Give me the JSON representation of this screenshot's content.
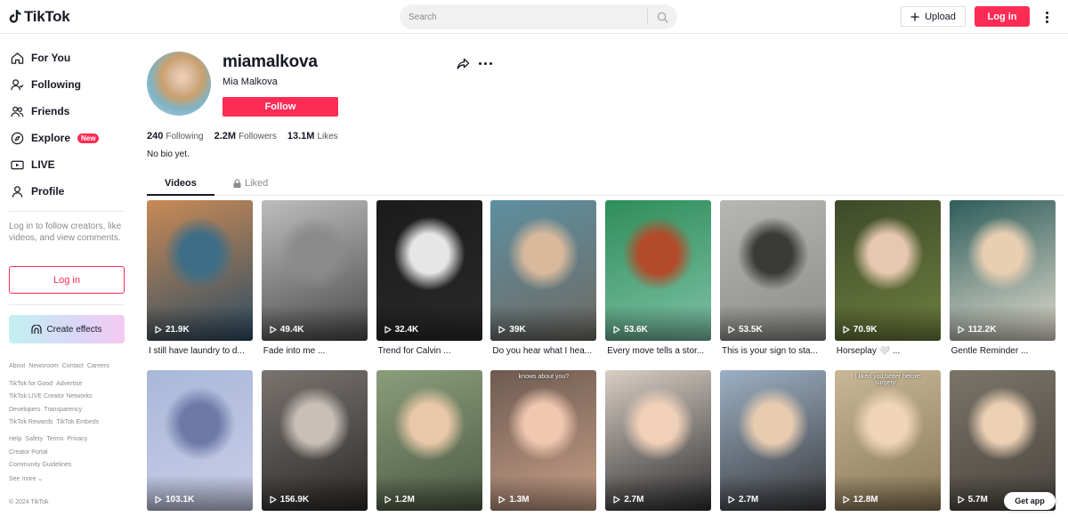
{
  "header": {
    "logo_text": "TikTok",
    "search_placeholder": "Search",
    "upload_label": "Upload",
    "login_label": "Log in"
  },
  "sidebar": {
    "nav": [
      {
        "label": "For You",
        "icon": "home-icon"
      },
      {
        "label": "Following",
        "icon": "following-icon"
      },
      {
        "label": "Friends",
        "icon": "friends-icon"
      },
      {
        "label": "Explore",
        "icon": "compass-icon",
        "badge": "New"
      },
      {
        "label": "LIVE",
        "icon": "live-icon"
      },
      {
        "label": "Profile",
        "icon": "profile-icon"
      }
    ],
    "login_message": "Log in to follow creators, like videos, and view comments.",
    "login_button": "Log in",
    "create_effects": "Create effects",
    "footer_rows": [
      [
        "About",
        "Newsroom",
        "Contact",
        "Careers"
      ],
      [
        "TikTok for Good",
        "Advertise"
      ],
      [
        "TikTok LIVE Creator Networks"
      ],
      [
        "Developers",
        "Transparency"
      ],
      [
        "TikTok Rewards",
        "TikTok Embeds"
      ],
      [
        "Help",
        "Safety",
        "Terms",
        "Privacy"
      ],
      [
        "Creator Portal"
      ],
      [
        "Community Guidelines"
      ],
      [
        "See more ⌄"
      ]
    ],
    "copyright": "© 2024 TikTok"
  },
  "profile": {
    "username": "miamalkova",
    "nickname": "Mia Malkova",
    "follow_label": "Follow",
    "stats": {
      "following_count": "240",
      "following_label": "Following",
      "followers_count": "2.2M",
      "followers_label": "Followers",
      "likes_count": "13.1M",
      "likes_label": "Likes"
    },
    "bio": "No bio yet."
  },
  "tabs": {
    "videos": "Videos",
    "liked": "Liked"
  },
  "videos": [
    {
      "views": "21.9K",
      "caption": "I still have laundry to d...",
      "colors": [
        "#c98a56",
        "#3e6e86",
        "#2e4d63"
      ]
    },
    {
      "views": "49.4K",
      "caption": "Fade into me ...",
      "colors": [
        "#bdbdbd",
        "#8a8a8a",
        "#4a4a4a"
      ]
    },
    {
      "views": "32.4K",
      "caption": "Trend for Calvin ...",
      "colors": [
        "#1b1b1b",
        "#e6e6e6",
        "#2a2a2a"
      ]
    },
    {
      "views": "39K",
      "caption": "Do you hear what I hea...",
      "colors": [
        "#5d8fa0",
        "#d9b99c",
        "#6f6a63"
      ]
    },
    {
      "views": "53.6K",
      "caption": "Every move tells a stor...",
      "colors": [
        "#2e8e59",
        "#b34a2a",
        "#7fc1a8"
      ]
    },
    {
      "views": "53.5K",
      "caption": "This is your sign to sta...",
      "colors": [
        "#b6b6b3",
        "#3a3a38",
        "#8d8c88"
      ]
    },
    {
      "views": "70.9K",
      "caption": "Horseplay 🤍 ...",
      "colors": [
        "#3d4a2a",
        "#e6c8b0",
        "#6f7f3e"
      ]
    },
    {
      "views": "112.2K",
      "caption": "Gentle Reminder ...",
      "colors": [
        "#2e5d5a",
        "#e9cfb2",
        "#e3dccf"
      ]
    },
    {
      "views": "103.1K",
      "caption": "",
      "colors": [
        "#a9b8d8",
        "#6d7aa8",
        "#c9cde8"
      ]
    },
    {
      "views": "156.9K",
      "caption": "",
      "colors": [
        "#7a7470",
        "#c8c0b8",
        "#2c2a28"
      ]
    },
    {
      "views": "1.2M",
      "caption": "",
      "colors": [
        "#8a9e7a",
        "#e8c8a8",
        "#4e5a44"
      ]
    },
    {
      "views": "1.3M",
      "caption": "",
      "colors": [
        "#6d5a50",
        "#f0c8b0",
        "#c8a088"
      ],
      "overlay": "knows about you?"
    },
    {
      "views": "2.7M",
      "caption": "",
      "colors": [
        "#d8cec4",
        "#f0d0b8",
        "#2e2e30"
      ]
    },
    {
      "views": "2.7M",
      "caption": "",
      "colors": [
        "#9cb0c4",
        "#e8ccb0",
        "#3a3a3c"
      ]
    },
    {
      "views": "12.8M",
      "caption": "",
      "colors": [
        "#c8b898",
        "#f0d4b8",
        "#8a7858"
      ],
      "overlay": "I liked you better before surgery..."
    },
    {
      "views": "5.7M",
      "caption": "",
      "colors": [
        "#7a7468",
        "#ecd0b4",
        "#4a4640"
      ]
    }
  ],
  "get_app": "Get app"
}
